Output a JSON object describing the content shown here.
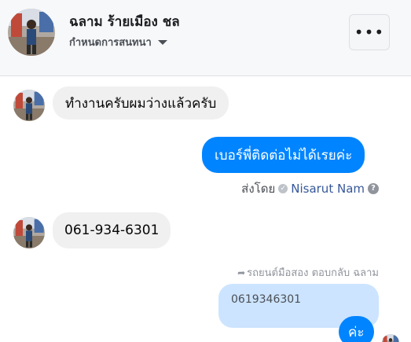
{
  "header": {
    "contact_name": "ฉลาม ร้ายเมือง ชล",
    "subtitle": "กำหนดการสนทนา",
    "more_label": "•••"
  },
  "messages": [
    {
      "direction": "incoming",
      "text": "ทำงานครับผมว่างแล้วครับ"
    },
    {
      "direction": "outgoing",
      "text": "เบอร์พี่ติดต่อไม่ได้เรยค่ะ"
    },
    {
      "direction": "incoming",
      "text": "061-934-6301"
    }
  ],
  "sent_by": {
    "prefix": "ส่งโดย",
    "sender": "Nisarut Nam",
    "help": "?"
  },
  "reply": {
    "note": "รถยนต์มือสอง ตอบกลับ ฉลาม",
    "quoted_text": "0619346301",
    "reply_text": "ค่ะ"
  },
  "icons": {
    "more": "more-options-icon",
    "caret": "caret-down-icon",
    "check": "check-icon",
    "help": "help-icon",
    "reply": "reply-icon"
  },
  "colors": {
    "outgoing_bubble": "#0084ff",
    "incoming_bubble": "#f0f0f0",
    "quoted_bubble": "#cce4ff",
    "link": "#365899"
  }
}
